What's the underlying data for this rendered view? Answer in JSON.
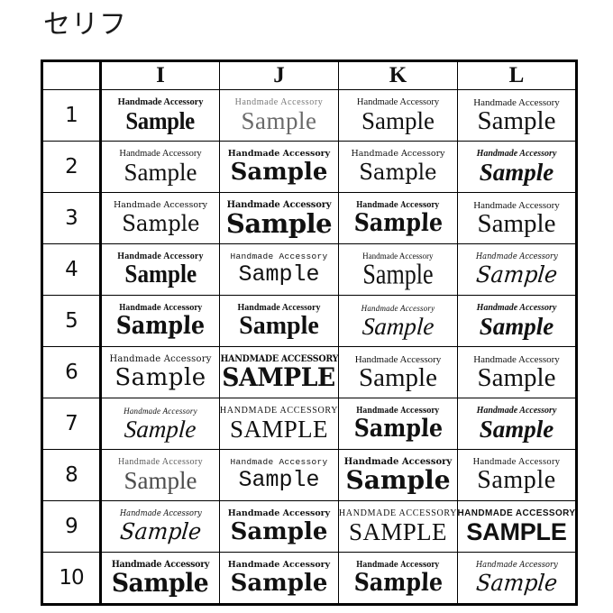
{
  "page": {
    "title": "セリフ",
    "background_color": "#ffffff",
    "text_color": "#111111"
  },
  "table": {
    "corner_label": "",
    "column_headers": [
      "I",
      "J",
      "K",
      "L"
    ],
    "row_labels": [
      "1",
      "2",
      "3",
      "4",
      "5",
      "6",
      "7",
      "8",
      "9",
      "10"
    ],
    "sample_sub_text": "Handmade Accessory",
    "sample_main_text": "Sample",
    "sample_sub_caps": "HANDMADE ACCESSORY",
    "sample_main_caps": "SAMPLE",
    "rows": [
      {
        "label": "1",
        "cells": [
          {
            "column": "I",
            "sub": "Handmade Accessory",
            "main": "Sample",
            "style": "s1"
          },
          {
            "column": "J",
            "sub": "Handmade Accessory",
            "main": "Sample",
            "style": "s2"
          },
          {
            "column": "K",
            "sub": "Handmade Accessory",
            "main": "Sample",
            "style": "s3"
          },
          {
            "column": "L",
            "sub": "Handmade Accessory",
            "main": "Sample",
            "style": "s22"
          }
        ]
      },
      {
        "label": "2",
        "cells": [
          {
            "column": "I",
            "sub": "Handmade Accessory",
            "main": "Sample",
            "style": "s3"
          },
          {
            "column": "J",
            "sub": "Handmade Accessory",
            "main": "Sample",
            "style": "s5"
          },
          {
            "column": "K",
            "sub": "Handmade Accessory",
            "main": "Sample",
            "style": "s4"
          },
          {
            "column": "L",
            "sub": "Handmade Accessory",
            "main": "Sample",
            "style": "s20"
          }
        ]
      },
      {
        "label": "3",
        "cells": [
          {
            "column": "I",
            "sub": "Handmade Accessory",
            "main": "Sample",
            "style": "s4"
          },
          {
            "column": "J",
            "sub": "Handmade Accessory",
            "main": "Sample",
            "style": "s6"
          },
          {
            "column": "K",
            "sub": "Handmade Accessory",
            "main": "Sample",
            "style": "s11"
          },
          {
            "column": "L",
            "sub": "Handmade Accessory",
            "main": "Sample",
            "style": "s22"
          }
        ]
      },
      {
        "label": "4",
        "cells": [
          {
            "column": "I",
            "sub": "Handmade Accessory",
            "main": "Sample",
            "style": "s9"
          },
          {
            "column": "J",
            "sub": "Handmade Accessory",
            "main": "Sample",
            "style": "s13"
          },
          {
            "column": "K",
            "sub": "Handmade Accessory",
            "main": "Sample",
            "style": "s19"
          },
          {
            "column": "L",
            "sub": "Handmade Accessory",
            "main": "Sample",
            "style": "s16"
          }
        ]
      },
      {
        "label": "5",
        "cells": [
          {
            "column": "I",
            "sub": "Handmade Accessory",
            "main": "Sample",
            "style": "s11"
          },
          {
            "column": "J",
            "sub": "Handmade Accessory",
            "main": "Sample",
            "style": "s12"
          },
          {
            "column": "K",
            "sub": "Handmade Accessory",
            "main": "Sample",
            "style": "s17"
          },
          {
            "column": "L",
            "sub": "Handmade Accessory",
            "main": "Sample",
            "style": "s8"
          }
        ]
      },
      {
        "label": "6",
        "cells": [
          {
            "column": "I",
            "sub": "Handmade Accessory",
            "main": "Sample",
            "style": "s10"
          },
          {
            "column": "J",
            "sub": "HANDMADE ACCESSORY",
            "main": "SAMPLE",
            "style": "s21"
          },
          {
            "column": "K",
            "sub": "Handmade Accessory",
            "main": "Sample",
            "style": "s22"
          },
          {
            "column": "L",
            "sub": "Handmade Accessory",
            "main": "Sample",
            "style": "s22"
          }
        ]
      },
      {
        "label": "7",
        "cells": [
          {
            "column": "I",
            "sub": "Handmade Accessory",
            "main": "Sample",
            "style": "s17"
          },
          {
            "column": "J",
            "sub": "HANDMADE ACCESSORY",
            "main": "SAMPLE",
            "style": "s14"
          },
          {
            "column": "K",
            "sub": "Handmade Accessory",
            "main": "Sample",
            "style": "s11"
          },
          {
            "column": "L",
            "sub": "Handmade Accessory",
            "main": "Sample",
            "style": "s20"
          }
        ]
      },
      {
        "label": "8",
        "cells": [
          {
            "column": "I",
            "sub": "Handmade Accessory",
            "main": "Sample",
            "style": "s18"
          },
          {
            "column": "J",
            "sub": "Handmade Accessory",
            "main": "Sample",
            "style": "s13"
          },
          {
            "column": "K",
            "sub": "Handmade Accessory",
            "main": "Sample",
            "style": "s24"
          },
          {
            "column": "L",
            "sub": "Handmade Accessory",
            "main": "Sample",
            "style": "s23"
          }
        ]
      },
      {
        "label": "9",
        "cells": [
          {
            "column": "I",
            "sub": "Handmade Accessory",
            "main": "Sample",
            "style": "s16"
          },
          {
            "column": "J",
            "sub": "Handmade Accessory",
            "main": "Sample",
            "style": "s5"
          },
          {
            "column": "K",
            "sub": "HANDMADE ACCESSORY",
            "main": "SAMPLE",
            "style": "s14"
          },
          {
            "column": "L",
            "sub": "HANDMADE ACCESSORY",
            "main": "SAMPLE",
            "style": "s15"
          }
        ]
      },
      {
        "label": "10",
        "cells": [
          {
            "column": "I",
            "sub": "Handmade Accessory",
            "main": "Sample",
            "style": "s21"
          },
          {
            "column": "J",
            "sub": "Handmade Accessory",
            "main": "Sample",
            "style": "s5"
          },
          {
            "column": "K",
            "sub": "Handmade Accessory",
            "main": "Sample",
            "style": "s11"
          },
          {
            "column": "L",
            "sub": "Handmade Accessory",
            "main": "Sample",
            "style": "s16"
          }
        ]
      }
    ]
  }
}
